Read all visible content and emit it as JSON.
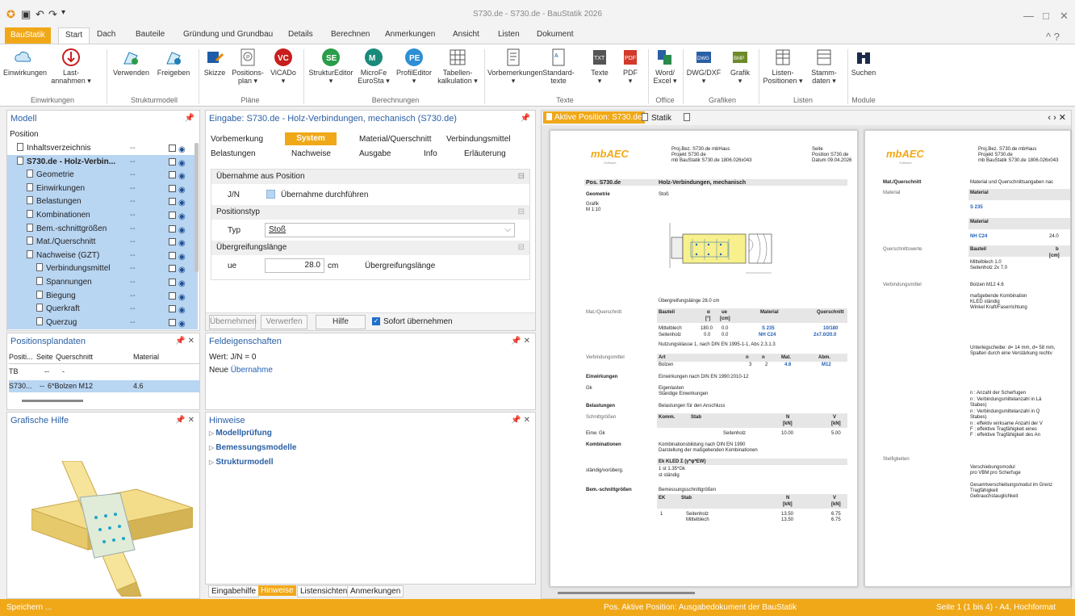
{
  "window": {
    "title": "S730.de - S730.de - BauStatik 2026"
  },
  "tabs": {
    "app": "BauStatik",
    "items": [
      "Start",
      "Dach",
      "Bauteile",
      "Gründung und Grundbau",
      "Details",
      "Berechnen",
      "Anmerkungen",
      "Ansicht",
      "Listen",
      "Dokument"
    ]
  },
  "ribbon": {
    "buttons": [
      "Einwirkungen",
      "Last-\nannahmen ▾",
      "Verwenden",
      "Freigeben",
      "Skizze",
      "Positions-\nplan ▾",
      "ViCADo\n▾",
      "StrukturEditor\n▾",
      "MicroFe\nEuroSta ▾",
      "ProfilEditor\n▾",
      "Tabellen-\nkalkulation ▾",
      "Vorbemerkungen\n▾",
      "Standard-\ntexte",
      "Texte\n▾",
      "PDF\n▾",
      "Word/\nExcel ▾",
      "DWG/DXF\n▾",
      "Grafik\n▾",
      "Listen-\nPositionen ▾",
      "Stamm-\ndaten ▾",
      "Suchen"
    ],
    "groups": [
      "Einwirkungen",
      "Strukturmodell",
      "Pläne",
      "Berechnungen",
      "Texte",
      "Office",
      "Grafiken",
      "Listen",
      "Module"
    ]
  },
  "model": {
    "title": "Modell",
    "header": "Position",
    "items": [
      {
        "label": "Inhaltsverzeichnis",
        "val": "--"
      },
      {
        "label": "S730.de - Holz-Verbin...",
        "val": "--"
      },
      {
        "label": "Geometrie",
        "val": "--"
      },
      {
        "label": "Einwirkungen",
        "val": "--"
      },
      {
        "label": "Belastungen",
        "val": "--"
      },
      {
        "label": "Kombinationen",
        "val": "--"
      },
      {
        "label": "Bem.-schnittgrößen",
        "val": "--"
      },
      {
        "label": "Mat./Querschnitt",
        "val": "--"
      },
      {
        "label": "Nachweise (GZT)",
        "val": "--"
      },
      {
        "label": "Verbindungsmittel",
        "val": "--"
      },
      {
        "label": "Spannungen",
        "val": "--"
      },
      {
        "label": "Biegung",
        "val": "--"
      },
      {
        "label": "Querkraft",
        "val": "--"
      },
      {
        "label": "Querzug",
        "val": "--"
      }
    ]
  },
  "plandata": {
    "title": "Positionsplandaten",
    "cols": [
      "Positi...",
      "Seite",
      "Querschnitt",
      "Material"
    ],
    "rows": [
      [
        "TB",
        "--",
        "-",
        ""
      ],
      [
        "S730...",
        "--",
        "6*Bolzen M12",
        "4.6"
      ]
    ]
  },
  "grafik": {
    "title": "Grafische Hilfe"
  },
  "eingabe": {
    "title": "Eingabe: S730.de - Holz-Verbindungen, mechanisch (S730.de)",
    "tabs1": [
      "Vorbemerkung",
      "System",
      "Material/Querschnitt",
      "Verbindungsmittel"
    ],
    "tabs2": [
      "Belastungen",
      "Nachweise",
      "Ausgabe",
      "Info",
      "Erläuterung"
    ],
    "sec1": "Übernahme aus Position",
    "jn_label": "J/N",
    "jn_text": "Übernahme durchführen",
    "sec2": "Positionstyp",
    "typ_label": "Typ",
    "typ_value": "Stoß",
    "sec3": "Übergreifungslänge",
    "ue_label": "ue",
    "ue_value": "28.0",
    "ue_unit": "cm",
    "ue_desc": "Übergreifungslänge",
    "buttons": [
      "Übernehmen",
      "Verwerfen",
      "Hilfe"
    ],
    "sofort": "Sofort übernehmen"
  },
  "feld": {
    "title": "Feldeigenschaften",
    "line1": "Wert: J/N = 0",
    "line2a": "Neue",
    "line2b": "Übernahme"
  },
  "hinweise": {
    "title": "Hinweise",
    "items": [
      "Modellprüfung",
      "Bemessungsmodelle",
      "Strukturmodell"
    ]
  },
  "bottomtabs": [
    "Eingabehilfe",
    "Hinweise",
    "Listensichten",
    "Anmerkungen"
  ],
  "doc": {
    "tab1": "Aktive Position: S730.de",
    "tab2": "Statik",
    "logo": "mbAEC",
    "logo_sub": "Software",
    "hdr": [
      "Proj.Bez. S730.de mbHaus",
      "Projekt  S730.de",
      "mb BauStatik S730.de 1806.026x043"
    ],
    "hdr_r": [
      "Seite",
      "Position  S730.de",
      "Datum  09.04.2026"
    ],
    "pos": "Pos. S730.de",
    "pos_title": "Holz-Verbindungen, mechanisch",
    "geometrie": "Geometrie",
    "stoss": "Stoß",
    "grafik": "Grafik",
    "massstab": "M 1:10",
    "ueber": "Übergreifungslänge 28.0 cm",
    "mat": "Mat./Querschnitt",
    "mat_cols": [
      "Bauteil",
      "α",
      "ue",
      "Material",
      "Querschnitt"
    ],
    "mat_units": [
      "[°]",
      "[cm]"
    ],
    "mat_rows": [
      [
        "Mittelblech",
        "180.0",
        "0.0",
        "S 235",
        "10/180"
      ],
      [
        "Seitenholz",
        "0.0",
        "0.0",
        "NH C24",
        "2x7.0/20.0"
      ]
    ],
    "nk": "Nutzungsklasse 1, nach DIN EN 1995-1-1, Abs 2.3.1.3",
    "vbm": "Verbindungsmittel",
    "vbm_cols": [
      "Art",
      "n",
      "n",
      "Mat.",
      "Abm."
    ],
    "vbm_row": [
      "Bolzen",
      "3",
      "2",
      "4.6",
      "M12"
    ],
    "einw": "Einwirkungen",
    "einw_t": "Einwirkungen nach DIN EN 1990:2010-12",
    "gk": "Gk",
    "gk_t1": "Eigenlasten",
    "gk_t2": "Ständige Einwirkungen",
    "bel": "Belastungen",
    "bel_t": "Belastungen für den Anschluss",
    "sg": "Schnittgrößen",
    "sg_cols": [
      "Komm.",
      "Stab",
      "N",
      "V"
    ],
    "sg_units": [
      "[kN]",
      "[kN]"
    ],
    "sg_row": [
      "Einw. Gk",
      "Seitenholz",
      "10.00",
      "5.00"
    ],
    "kombi": "Kombinationen",
    "kombi_t1": "Kombinationsbildung nach DIN EN 1990",
    "kombi_t2": "Darstellung der maßgebenden Kombinationen",
    "kombi_h": "Ek   KLED  Σ (γ*ψ*EW)",
    "kombi_l": "ständig/vorüberg.",
    "kombi_r": "1    st    1.35*Gk",
    "kombi_st": "st   ständig",
    "bem": "Bem.-schnittgrößen",
    "bem_t": "Bemessungsschnittgrößen",
    "bem_cols": [
      "EK",
      "Stab",
      "N",
      "V"
    ],
    "bem_units": [
      "[kN]",
      "[kN]"
    ],
    "bem_rows": [
      [
        "1",
        "Seitenholz",
        "13.50",
        "6.75"
      ],
      [
        "",
        "Mittelblech",
        "13.50",
        "6.75"
      ]
    ],
    "p2_mat": "Mat./Querschnitt",
    "p2_mat_t": "Material und Querschnittsangaben nac",
    "p2_material": "Material",
    "p2_s235": "S 235",
    "p2_nhc24": "NH C24",
    "p2_fmk": "24.0",
    "p2_qw": "Querschnittswerte",
    "p2_bauteil": "Bauteil",
    "p2_b": "b",
    "p2_cm": "[cm]",
    "p2_r1": "Mittelblech  1.0",
    "p2_r2": "Seitenholz  2x  7.0",
    "p2_vbm": "Verbindungsmittel",
    "p2_bolzen": "Bolzen M12 4.6",
    "p2_mk": "maßgebende Kombination",
    "p2_kled": "KLED ständig",
    "p2_winkel": "Winkel Kraft/Faserrichtung",
    "p2_unter": "Unterlegscheibe: d= 14 mm, d= 58 mm,",
    "p2_spalt": "Spalten durch eine Verstärkung rechtv",
    "p2_n1": "n  : Anzahl der Scherfugen",
    "p2_n2": "n   : Verbindungsmittelanzahl in Lä",
    "p2_n3": "n   : Verbindungsmittelanzahl in Q",
    "p2_n4": "n   : effektiv wirksame Anzahl der V",
    "p2_n5": "F   : effektive Tragfähigkeit eines",
    "p2_n6": "F   : effektive Tragfähigkeit des An",
    "p2_stab": "Stabes)",
    "p2_steif": "Steifigkeiten",
    "p2_vs": "Verschiebungsmodul",
    "p2_vbmpro": "pro VBM pro Scherfuge",
    "p2_gv": "Gesamtverschiebungsmodul im Grenz",
    "p2_tf": "Tragfähigkeit",
    "p2_gt": "Gebrauchstauglichkeit"
  },
  "status": {
    "left": "Speichern ...",
    "mid": "Pos. Aktive Position: Ausgabedokument der BauStatik",
    "right": "Seite 1 (1 bis 4) - A4, Hochformat"
  },
  "colors": {
    "accent": "#f0a818",
    "selection": "#b8d5f2",
    "link": "#1f5fb5"
  }
}
